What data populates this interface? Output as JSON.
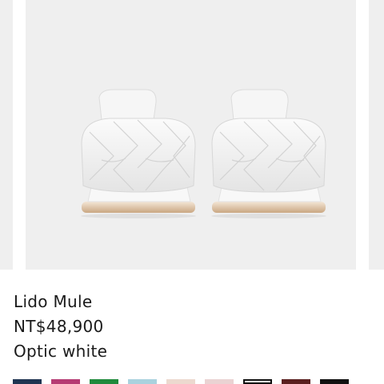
{
  "product": {
    "name": "Lido Mule",
    "price": "NT$48,900",
    "color": "Optic white"
  },
  "image": {
    "icon": "white-woven-leather-mule-pair"
  },
  "swatches": [
    {
      "color": "#1f3552"
    },
    {
      "color": "#b53b73"
    },
    {
      "color": "#1f8a3c"
    },
    {
      "color": "#a9d2de"
    },
    {
      "color": "#ecd9cf"
    },
    {
      "color": "#ead3d3"
    },
    {
      "color": "#ffffff",
      "selected": true
    },
    {
      "color": "#5a1f1f"
    },
    {
      "color": "#111111"
    }
  ]
}
